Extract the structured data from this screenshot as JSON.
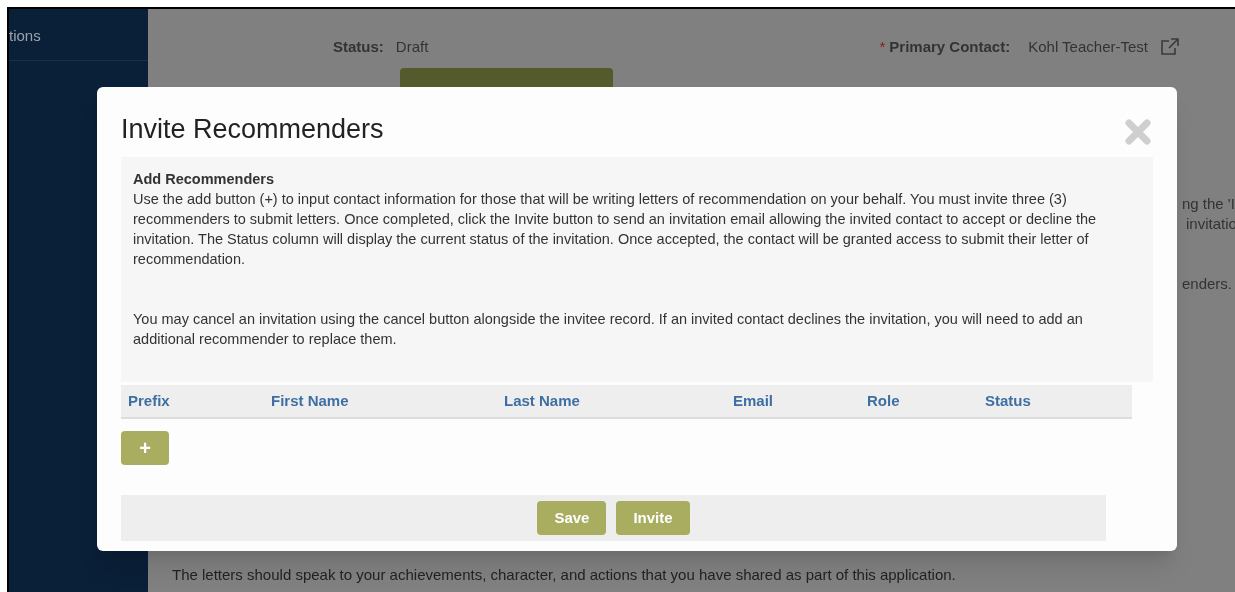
{
  "sidebar": {
    "items": [
      {
        "label": "tions"
      }
    ]
  },
  "background_page": {
    "status_label": "Status:",
    "status_value": "Draft",
    "primary_contact_label": "Primary Contact:",
    "primary_contact_required_mark": "*",
    "primary_contact_value": "Kohl Teacher-Test",
    "fragments": [
      "ng the 'I",
      "invitatio",
      "enders."
    ],
    "footer_text": "The letters should speak to your achievements, character, and actions that you have shared as part of this application."
  },
  "dialog": {
    "title": "Invite Recommenders",
    "heading": "Add Recommenders",
    "paragraphs": [
      "Use the add button (+) to input contact information for those that will be writing letters of recommendation on your behalf. You must invite three (3) recommenders to submit letters. Once completed, click the Invite button to send an invitation email allowing the invited contact to accept or decline the invitation. The Status column will display the current status of the invitation. Once accepted, the contact will be granted access to submit their letter of recommendation.",
      "You may cancel an invitation using the cancel button alongside the invitee record. If an invited contact declines the invitation, you will need to add an additional recommender to replace them."
    ],
    "table": {
      "columns": [
        "Prefix",
        "First Name",
        "Last Name",
        "Email",
        "Role",
        "Status"
      ]
    },
    "add_button": "+",
    "buttons": [
      "Save",
      "Invite"
    ]
  }
}
